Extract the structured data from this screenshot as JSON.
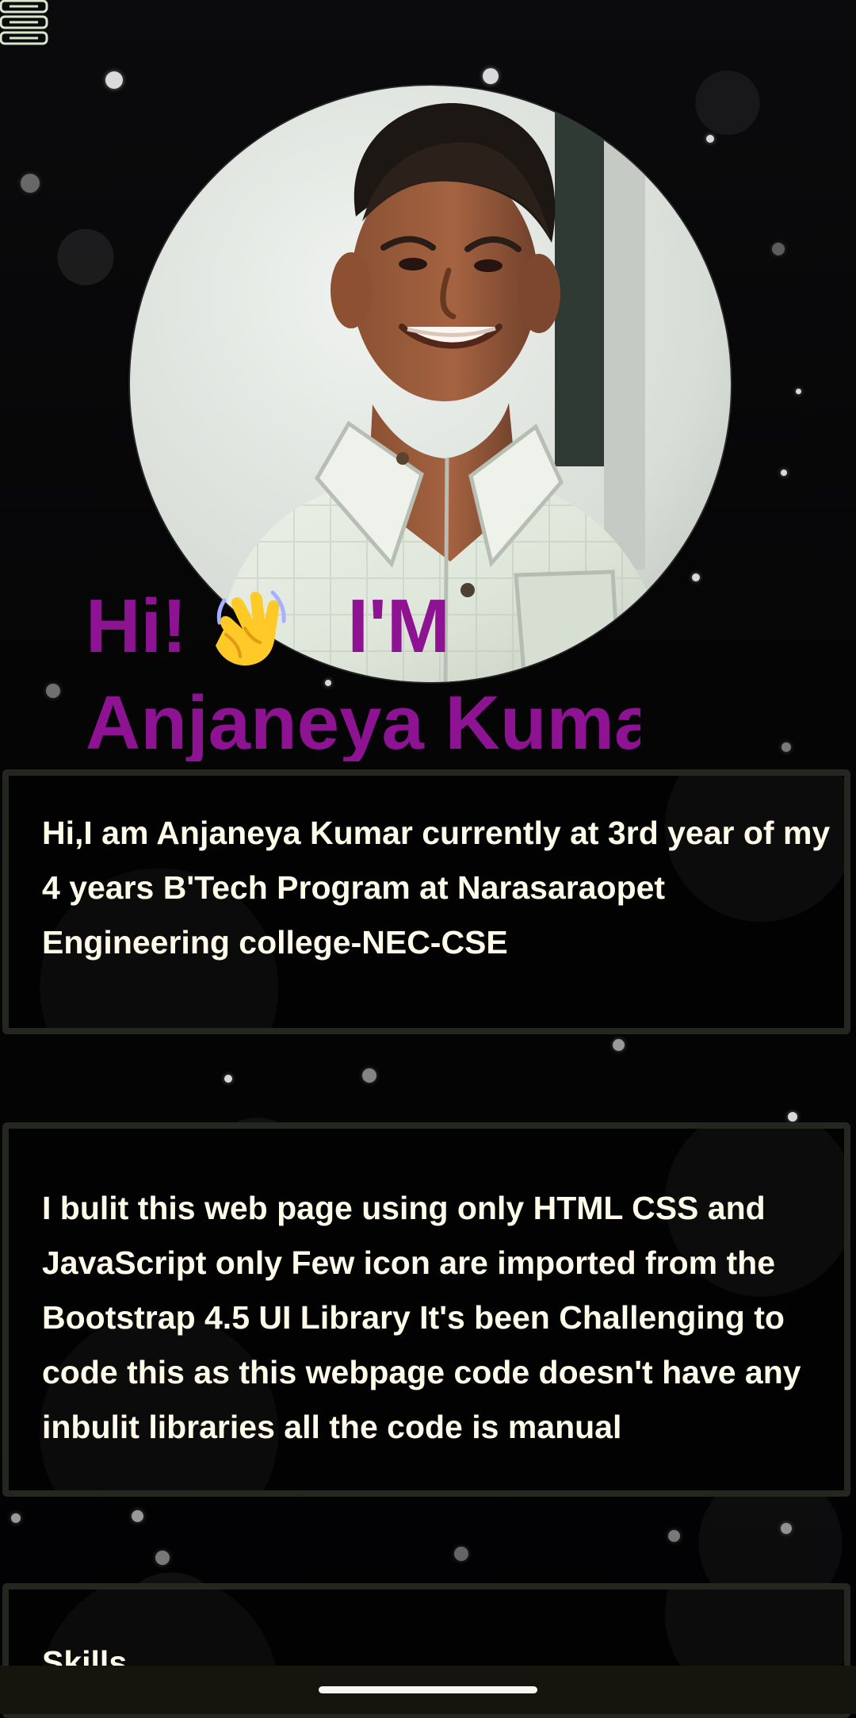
{
  "menu": {
    "icon": "menu-icon"
  },
  "profile": {
    "image_alt": "Anjaneya Kumar"
  },
  "hero": {
    "greeting": "Hi!",
    "wave_icon": "waving-hand-icon",
    "intro": "I'M",
    "name": "Anjaneya Kuma"
  },
  "cards": [
    {
      "text": "Hi,I am Anjaneya Kumar currently at 3rd year of my 4 years B'Tech Program at Narasaraopet Engineering college-NEC-CSE"
    },
    {
      "text": "I bulit this web page using only HTML CSS and JavaScript only Few icon are imported from the Bootstrap 4.5 UI Library It's been Challenging to code this as this webpage code doesn't have any inbulit libraries all the code is manual"
    },
    {
      "text": "Skills"
    }
  ],
  "system": {
    "home_indicator": "home-indicator"
  },
  "colors": {
    "accent": "#8d1393",
    "text": "#fffbe8",
    "card_border": "#24271f",
    "background": "#020203"
  }
}
